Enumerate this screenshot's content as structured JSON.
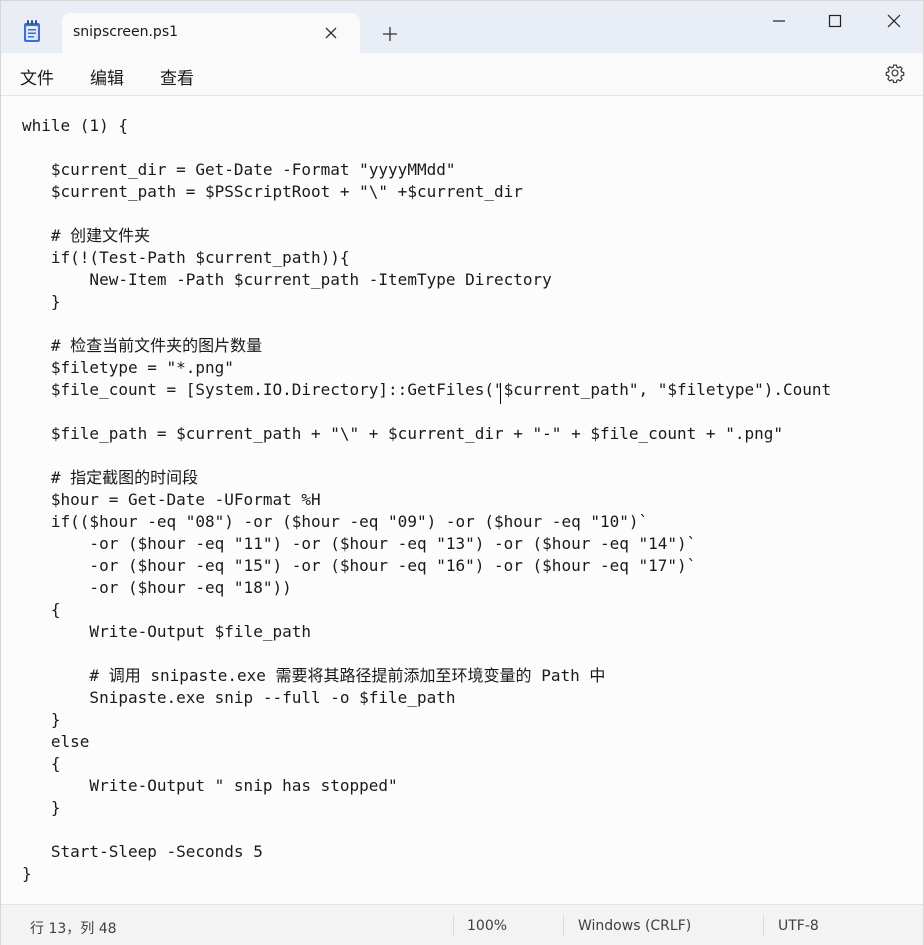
{
  "tab": {
    "title": "snipscreen.ps1"
  },
  "menu": {
    "items": [
      "文件",
      "编辑",
      "查看"
    ]
  },
  "editor": {
    "content": "while (1) {\n\n   $current_dir = Get-Date -Format \"yyyyMMdd\"\n   $current_path = $PSScriptRoot + \"\\\" +$current_dir\n\n   # 创建文件夹\n   if(!(Test-Path $current_path)){\n       New-Item -Path $current_path -ItemType Directory\n   }\n\n   # 检查当前文件夹的图片数量\n   $filetype = \"*.png\"\n   $file_count = [System.IO.Directory]::GetFiles(\"$current_path\", \"$filetype\").Count\n\n   $file_path = $current_path + \"\\\" + $current_dir + \"-\" + $file_count + \".png\"\n\n   # 指定截图的时间段\n   $hour = Get-Date -UFormat %H\n   if(($hour -eq \"08\") -or ($hour -eq \"09\") -or ($hour -eq \"10\")`\n       -or ($hour -eq \"11\") -or ($hour -eq \"13\") -or ($hour -eq \"14\")`\n       -or ($hour -eq \"15\") -or ($hour -eq \"16\") -or ($hour -eq \"17\")`\n       -or ($hour -eq \"18\"))\n   {\n       Write-Output $file_path\n\n       # 调用 snipaste.exe 需要将其路径提前添加至环境变量的 Path 中\n       Snipaste.exe snip --full -o $file_path\n   }\n   else\n   {\n       Write-Output \" snip has stopped\"\n   }\n\n   Start-Sleep -Seconds 5\n}"
  },
  "status": {
    "position": "行 13，列 48",
    "zoom": "100%",
    "line_ending": "Windows (CRLF)",
    "encoding": "UTF-8"
  },
  "icons": {
    "app": "notepad-icon",
    "close_tab": "close-icon",
    "new_tab": "plus-icon",
    "minimize": "minimize-icon",
    "maximize": "maximize-icon",
    "close_window": "close-icon",
    "settings": "gear-icon"
  }
}
